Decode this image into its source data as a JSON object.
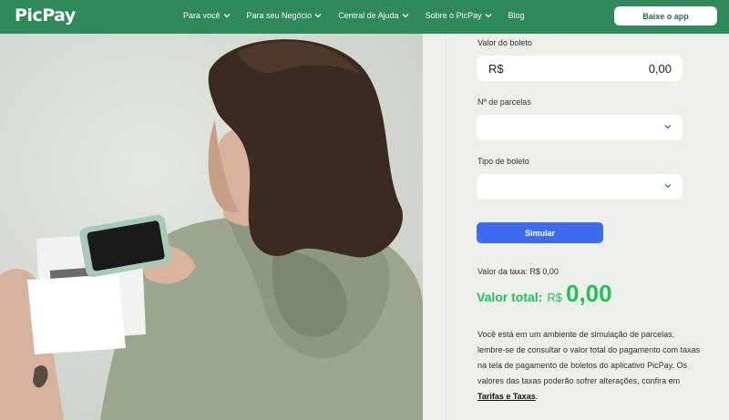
{
  "header": {
    "logo": "PicPay",
    "nav": [
      {
        "label": "Para você",
        "has_dropdown": true
      },
      {
        "label": "Para seu Negócio",
        "has_dropdown": true
      },
      {
        "label": "Central de Ajuda",
        "has_dropdown": true
      },
      {
        "label": "Sobre o PicPay",
        "has_dropdown": true
      },
      {
        "label": "Blog",
        "has_dropdown": false
      }
    ],
    "app_button": "Baixe o app"
  },
  "form": {
    "valor_label": "Valor do boleto",
    "valor_currency": "R$",
    "valor_value": "0,00",
    "parcelas_label": "Nº de parcelas",
    "parcelas_value": "",
    "tipo_label": "Tipo de boleto",
    "tipo_value": "",
    "simular_button": "Simular"
  },
  "result": {
    "taxa": "Valor da taxa: R$ 0,00",
    "total_label": "Valor total:",
    "total_currency": "R$",
    "total_value": "0,00"
  },
  "info": {
    "text": "Você está em um ambiente de simulação de parcelas, lembre-se de consultar o valor total do pagamento com taxas na tela de pagamento de boletos do aplicativo PicPay. Os valores das taxas poderão sofrer alterações, confira em",
    "link": "Tarifas e Taxas",
    "end": "."
  },
  "colors": {
    "header_bg": "#2e8a58",
    "simulate_button": "#3d6bf2",
    "total_green": "#21c25e"
  }
}
